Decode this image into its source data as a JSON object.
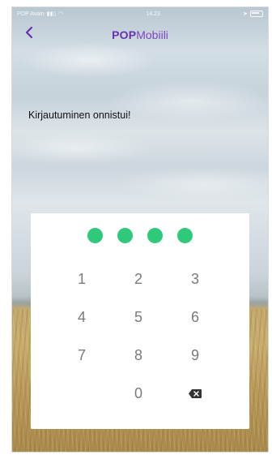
{
  "status_bar": {
    "carrier": "POP Avain",
    "time": "14.23"
  },
  "header": {
    "brand_bold": "POP",
    "brand_rest": "Mobiili"
  },
  "main": {
    "message": "Kirjautuminen onnistui!"
  },
  "pin_pad": {
    "filled_dots": 4,
    "keys": [
      "1",
      "2",
      "3",
      "4",
      "5",
      "6",
      "7",
      "8",
      "9",
      "",
      "0",
      "delete"
    ]
  },
  "colors": {
    "accent": "#6a2fb2",
    "dot": "#2ec97a"
  },
  "icons": {
    "back": "chevron-left-icon",
    "delete": "backspace-icon"
  }
}
